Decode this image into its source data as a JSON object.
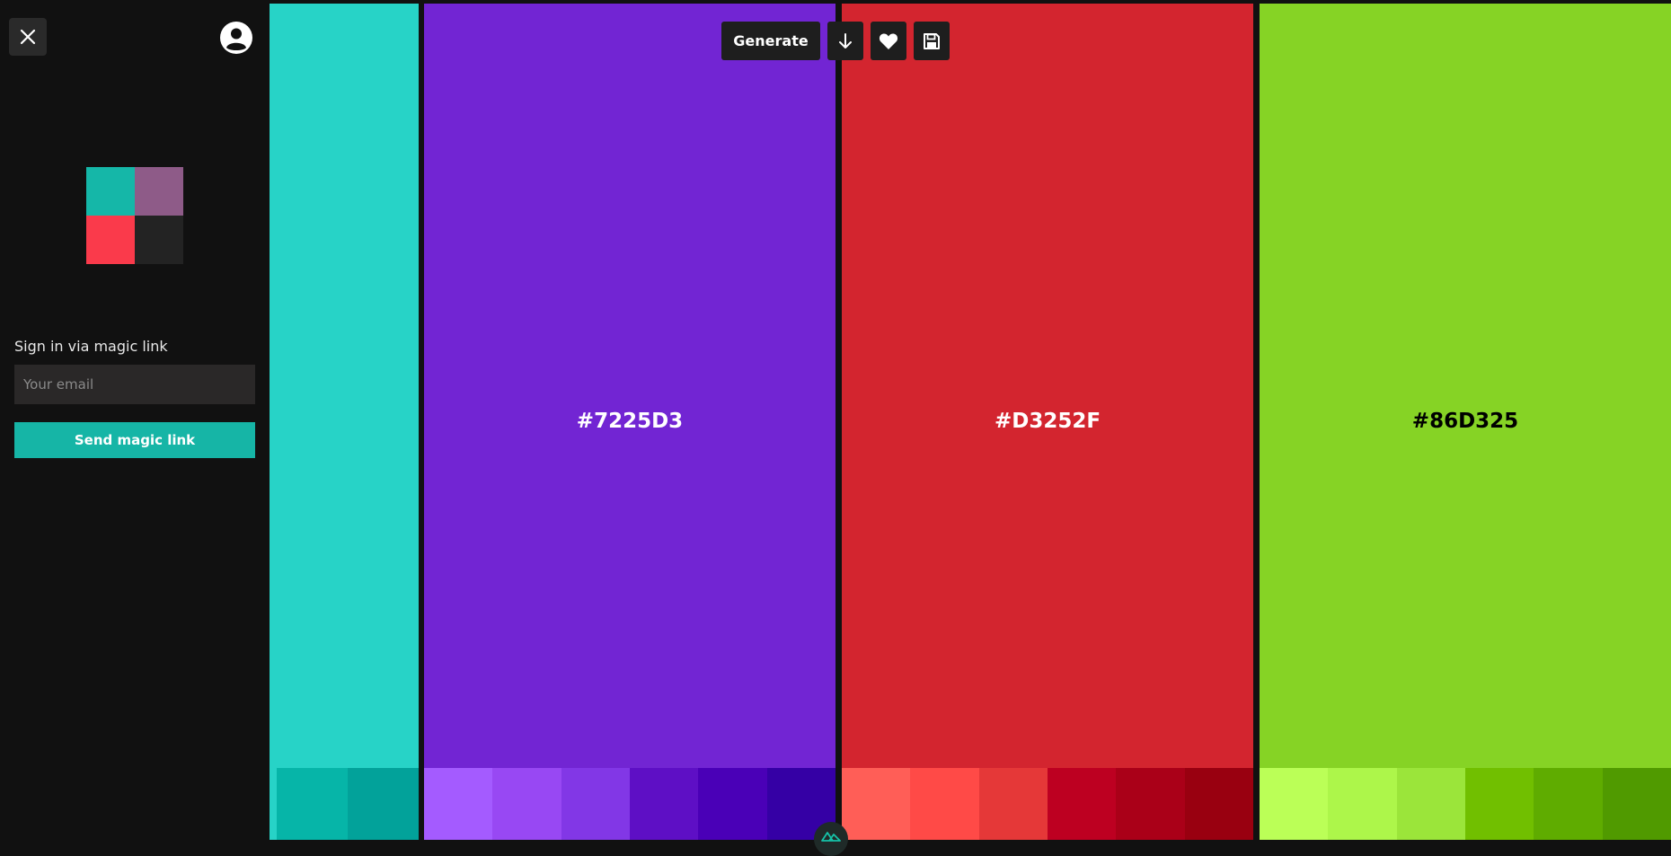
{
  "sidebar": {
    "signin_label": "Sign in via magic link",
    "email_placeholder": "Your email",
    "email_value": "",
    "send_button_label": "Send magic link",
    "logo_colors": [
      "#15b7a8",
      "#8e5b88",
      "#fa3a4b",
      "#232323"
    ]
  },
  "toolbar": {
    "generate_label": "Generate",
    "icons": [
      "arrow-down-icon",
      "heart-icon",
      "save-icon"
    ]
  },
  "palette": {
    "columns": [
      {
        "color": "#27D3C7",
        "hex": "",
        "label_color": "#ffffff",
        "shades": [
          "#27D3C7",
          "#06B5A8",
          "#02A29A"
        ]
      },
      {
        "color": "#7225D3",
        "hex": "#7225D3",
        "label_color": "#ffffff",
        "shades": [
          "#A45BFF",
          "#9848F3",
          "#8237E6",
          "#5E0FC5",
          "#4A00B7",
          "#3500A5"
        ]
      },
      {
        "color": "#D3252F",
        "hex": "#D3252F",
        "label_color": "#ffffff",
        "shades": [
          "#FF5E57",
          "#FF4A47",
          "#E53838",
          "#BD0021",
          "#AA0018",
          "#990010"
        ]
      },
      {
        "color": "#86D325",
        "hex": "#86D325",
        "label_color": "#000000",
        "shades": [
          "#BBFF57",
          "#ADF64A",
          "#9BE53A",
          "#71BF00",
          "#5FAC00",
          "#509A00"
        ]
      }
    ]
  }
}
